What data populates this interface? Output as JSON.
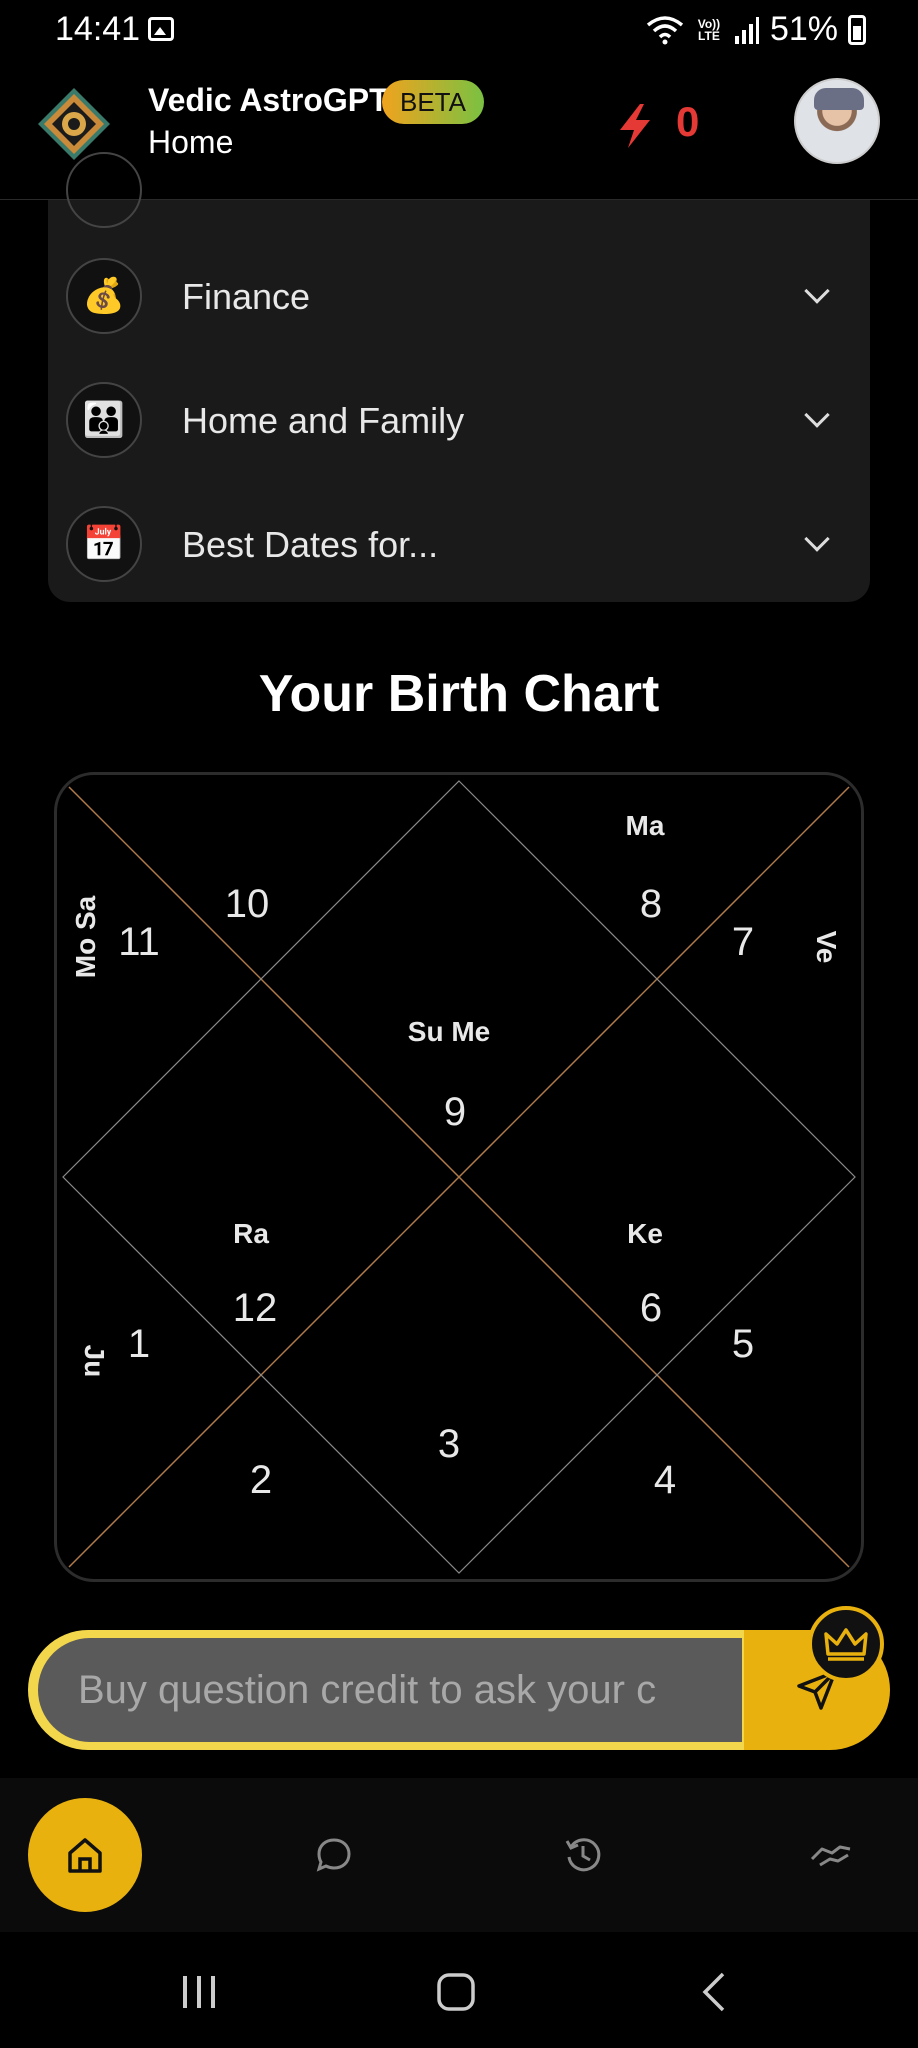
{
  "status_bar": {
    "time": "14:41",
    "network": "Vo)) LTE",
    "battery": "51%"
  },
  "header": {
    "title": "Vedic AstroGPT",
    "badge": "BETA",
    "subtitle": "Home",
    "credits": "0",
    "colors": {
      "credits": "#e53935",
      "badge_start": "#f0a31e",
      "badge_end": "#7ac142"
    }
  },
  "categories": [
    {
      "label": "Finance",
      "icon": "money-bag-icon",
      "glyph": "💰"
    },
    {
      "label": "Home and Family",
      "icon": "family-icon",
      "glyph": "👪"
    },
    {
      "label": "Best Dates for...",
      "icon": "calendar-icon",
      "glyph": "📅"
    }
  ],
  "birth_chart": {
    "title": "Your Birth Chart",
    "houses": {
      "h1": "1",
      "h2": "2",
      "h3": "3",
      "h4": "4",
      "h5": "5",
      "h6": "6",
      "h7": "7",
      "h8": "8",
      "h9": "9",
      "h10": "10",
      "h11": "11",
      "h12": "12"
    },
    "planets": {
      "h1": "Ju",
      "h6": "Ke",
      "h7": "Ve",
      "h8": "Ma",
      "h9": "Su Me",
      "h11": "Mo Sa",
      "h12": "Ra"
    }
  },
  "ask": {
    "placeholder": "Buy question credit to ask your c",
    "accent": "#e9b10e"
  },
  "bottom_nav": {
    "items": [
      "home-icon",
      "chat-icon",
      "history-icon",
      "handshake-icon"
    ]
  }
}
